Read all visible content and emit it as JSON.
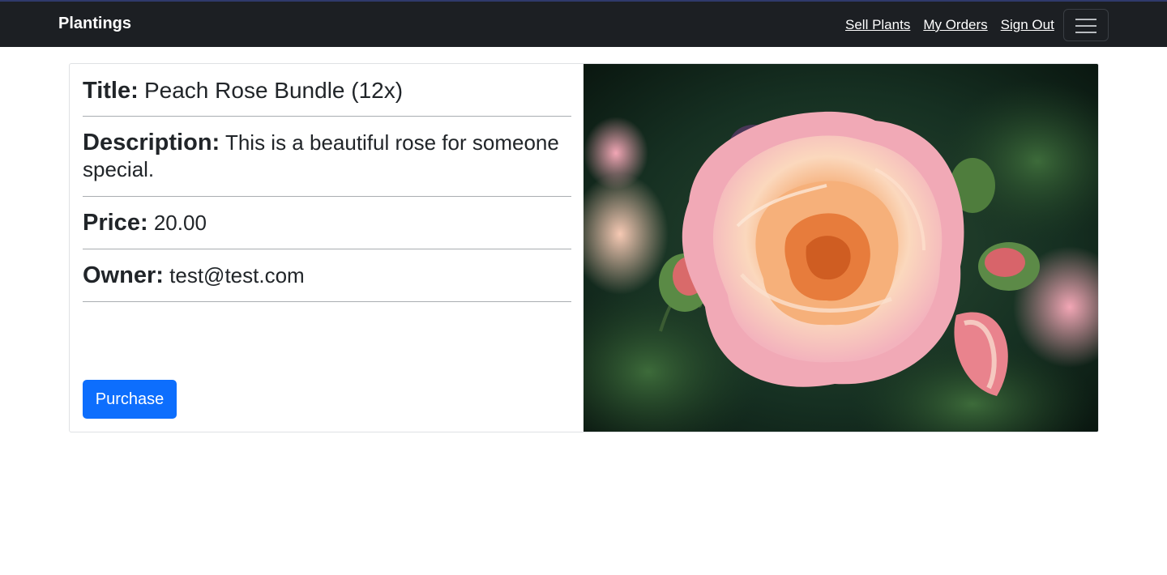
{
  "navbar": {
    "brand": "Plantings",
    "links": [
      "Sell Plants",
      "My Orders",
      "Sign Out"
    ],
    "toggler_icon": "hamburger-icon"
  },
  "listing": {
    "title_label": "Title:",
    "title_value": "Peach Rose Bundle (12x)",
    "description_label": "Description:",
    "description_value": "This is a beautiful rose for someone special.",
    "price_label": "Price:",
    "price_value": "20.00",
    "owner_label": "Owner:",
    "owner_value": "test@test.com",
    "purchase_label": "Purchase",
    "image_subject": "peach-rose-photo"
  },
  "colors": {
    "navbar_bg": "#1c1f23",
    "primary": "#0d6efd"
  }
}
